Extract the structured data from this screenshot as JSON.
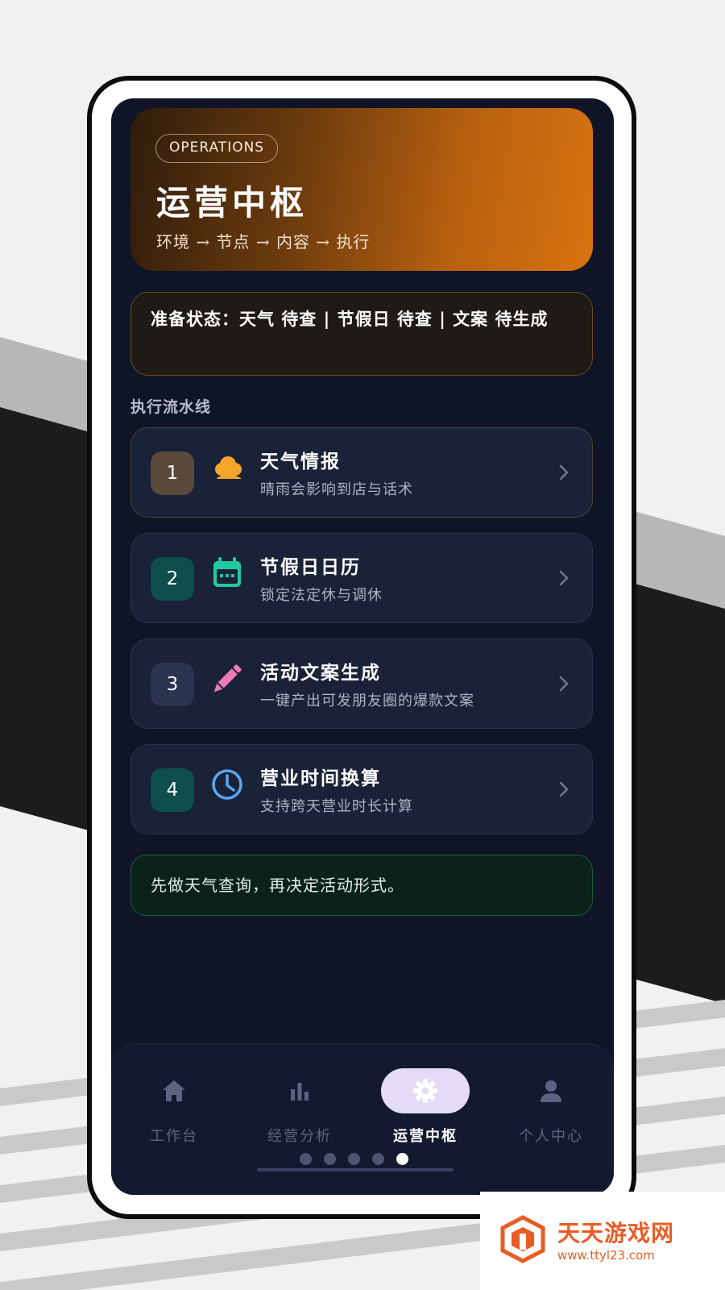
{
  "hero": {
    "tag": "OPERATIONS",
    "title": "运营中枢",
    "subtitle": "环境 → 节点 → 内容 → 执行"
  },
  "status": {
    "text": "准备状态：天气 待查 | 节假日 待查 | 文案 待生成"
  },
  "pipeline": {
    "section_label": "执行流水线",
    "items": [
      {
        "number": "1",
        "icon": "cloud-icon",
        "title": "天气情报",
        "desc": "晴雨会影响到店与话术",
        "number_color": "#5a4a3c",
        "icon_color": "#f6a52a"
      },
      {
        "number": "2",
        "icon": "calendar-icon",
        "title": "节假日日历",
        "desc": "锁定法定休与调休",
        "number_color": "#0e4e4c",
        "icon_color": "#23c9a0"
      },
      {
        "number": "3",
        "icon": "pencil-icon",
        "title": "活动文案生成",
        "desc": "一键产出可发朋友圈的爆款文案",
        "number_color": "#2a3350",
        "icon_color": "#f279b8"
      },
      {
        "number": "4",
        "icon": "clock-icon",
        "title": "营业时间换算",
        "desc": "支持跨天营业时长计算",
        "number_color": "#0e4e4c",
        "icon_color": "#5aa7f2"
      }
    ]
  },
  "tip": {
    "text": "先做天气查询，再决定活动形式。"
  },
  "nav": {
    "items": [
      {
        "label": "工作台",
        "icon": "home-icon",
        "active": false
      },
      {
        "label": "经营分析",
        "icon": "bar-chart-icon",
        "active": false
      },
      {
        "label": "运营中枢",
        "icon": "gear-icon",
        "active": true
      },
      {
        "label": "个人中心",
        "icon": "person-icon",
        "active": false
      }
    ]
  },
  "pager": {
    "count": 5,
    "active_index": 4
  },
  "watermark": {
    "name": "天天游戏网",
    "url": "www.ttyl23.com"
  },
  "colors": {
    "hero_gradient_start": "#2e1c0c",
    "hero_gradient_end": "#d9730f",
    "screen_bg": "#0f1527",
    "card_bg": "#1a2238",
    "tip_border": "#1e5a43",
    "watermark": "#e85d25"
  }
}
